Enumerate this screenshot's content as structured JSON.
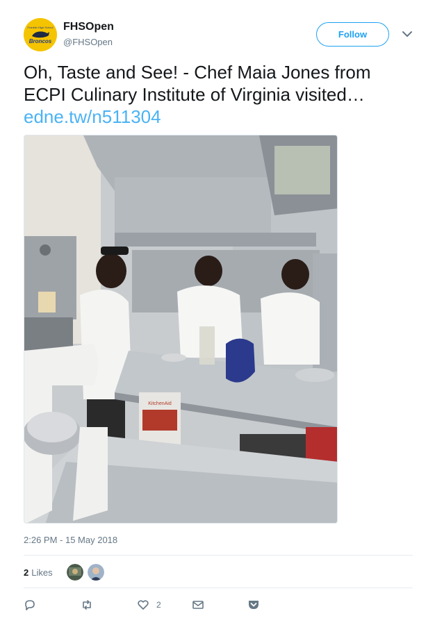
{
  "account": {
    "display_name": "FHSOpen",
    "handle": "@FHSOpen",
    "avatar_text_top": "Franklin High School",
    "avatar_text_main": "Broncos"
  },
  "follow_label": "Follow",
  "tweet": {
    "text": "Oh, Taste and See! - Chef Maia Jones from ECPI Culinary Institute of Virginia visited…",
    "link": "edne.tw/n511304"
  },
  "photo": {
    "product_box_brand": "KitchenAid"
  },
  "timestamp": "2:26 PM - 15 May 2018",
  "likes": {
    "count": "2",
    "label": "Likes"
  },
  "actions": {
    "like_count": "2"
  },
  "colors": {
    "accent": "#1da1f2",
    "link": "#4ab3f4",
    "avatar_bg": "#f5c400"
  },
  "icons": [
    "chevron-down-icon",
    "reply-icon",
    "retweet-icon",
    "heart-icon",
    "mail-icon",
    "pocket-icon"
  ]
}
